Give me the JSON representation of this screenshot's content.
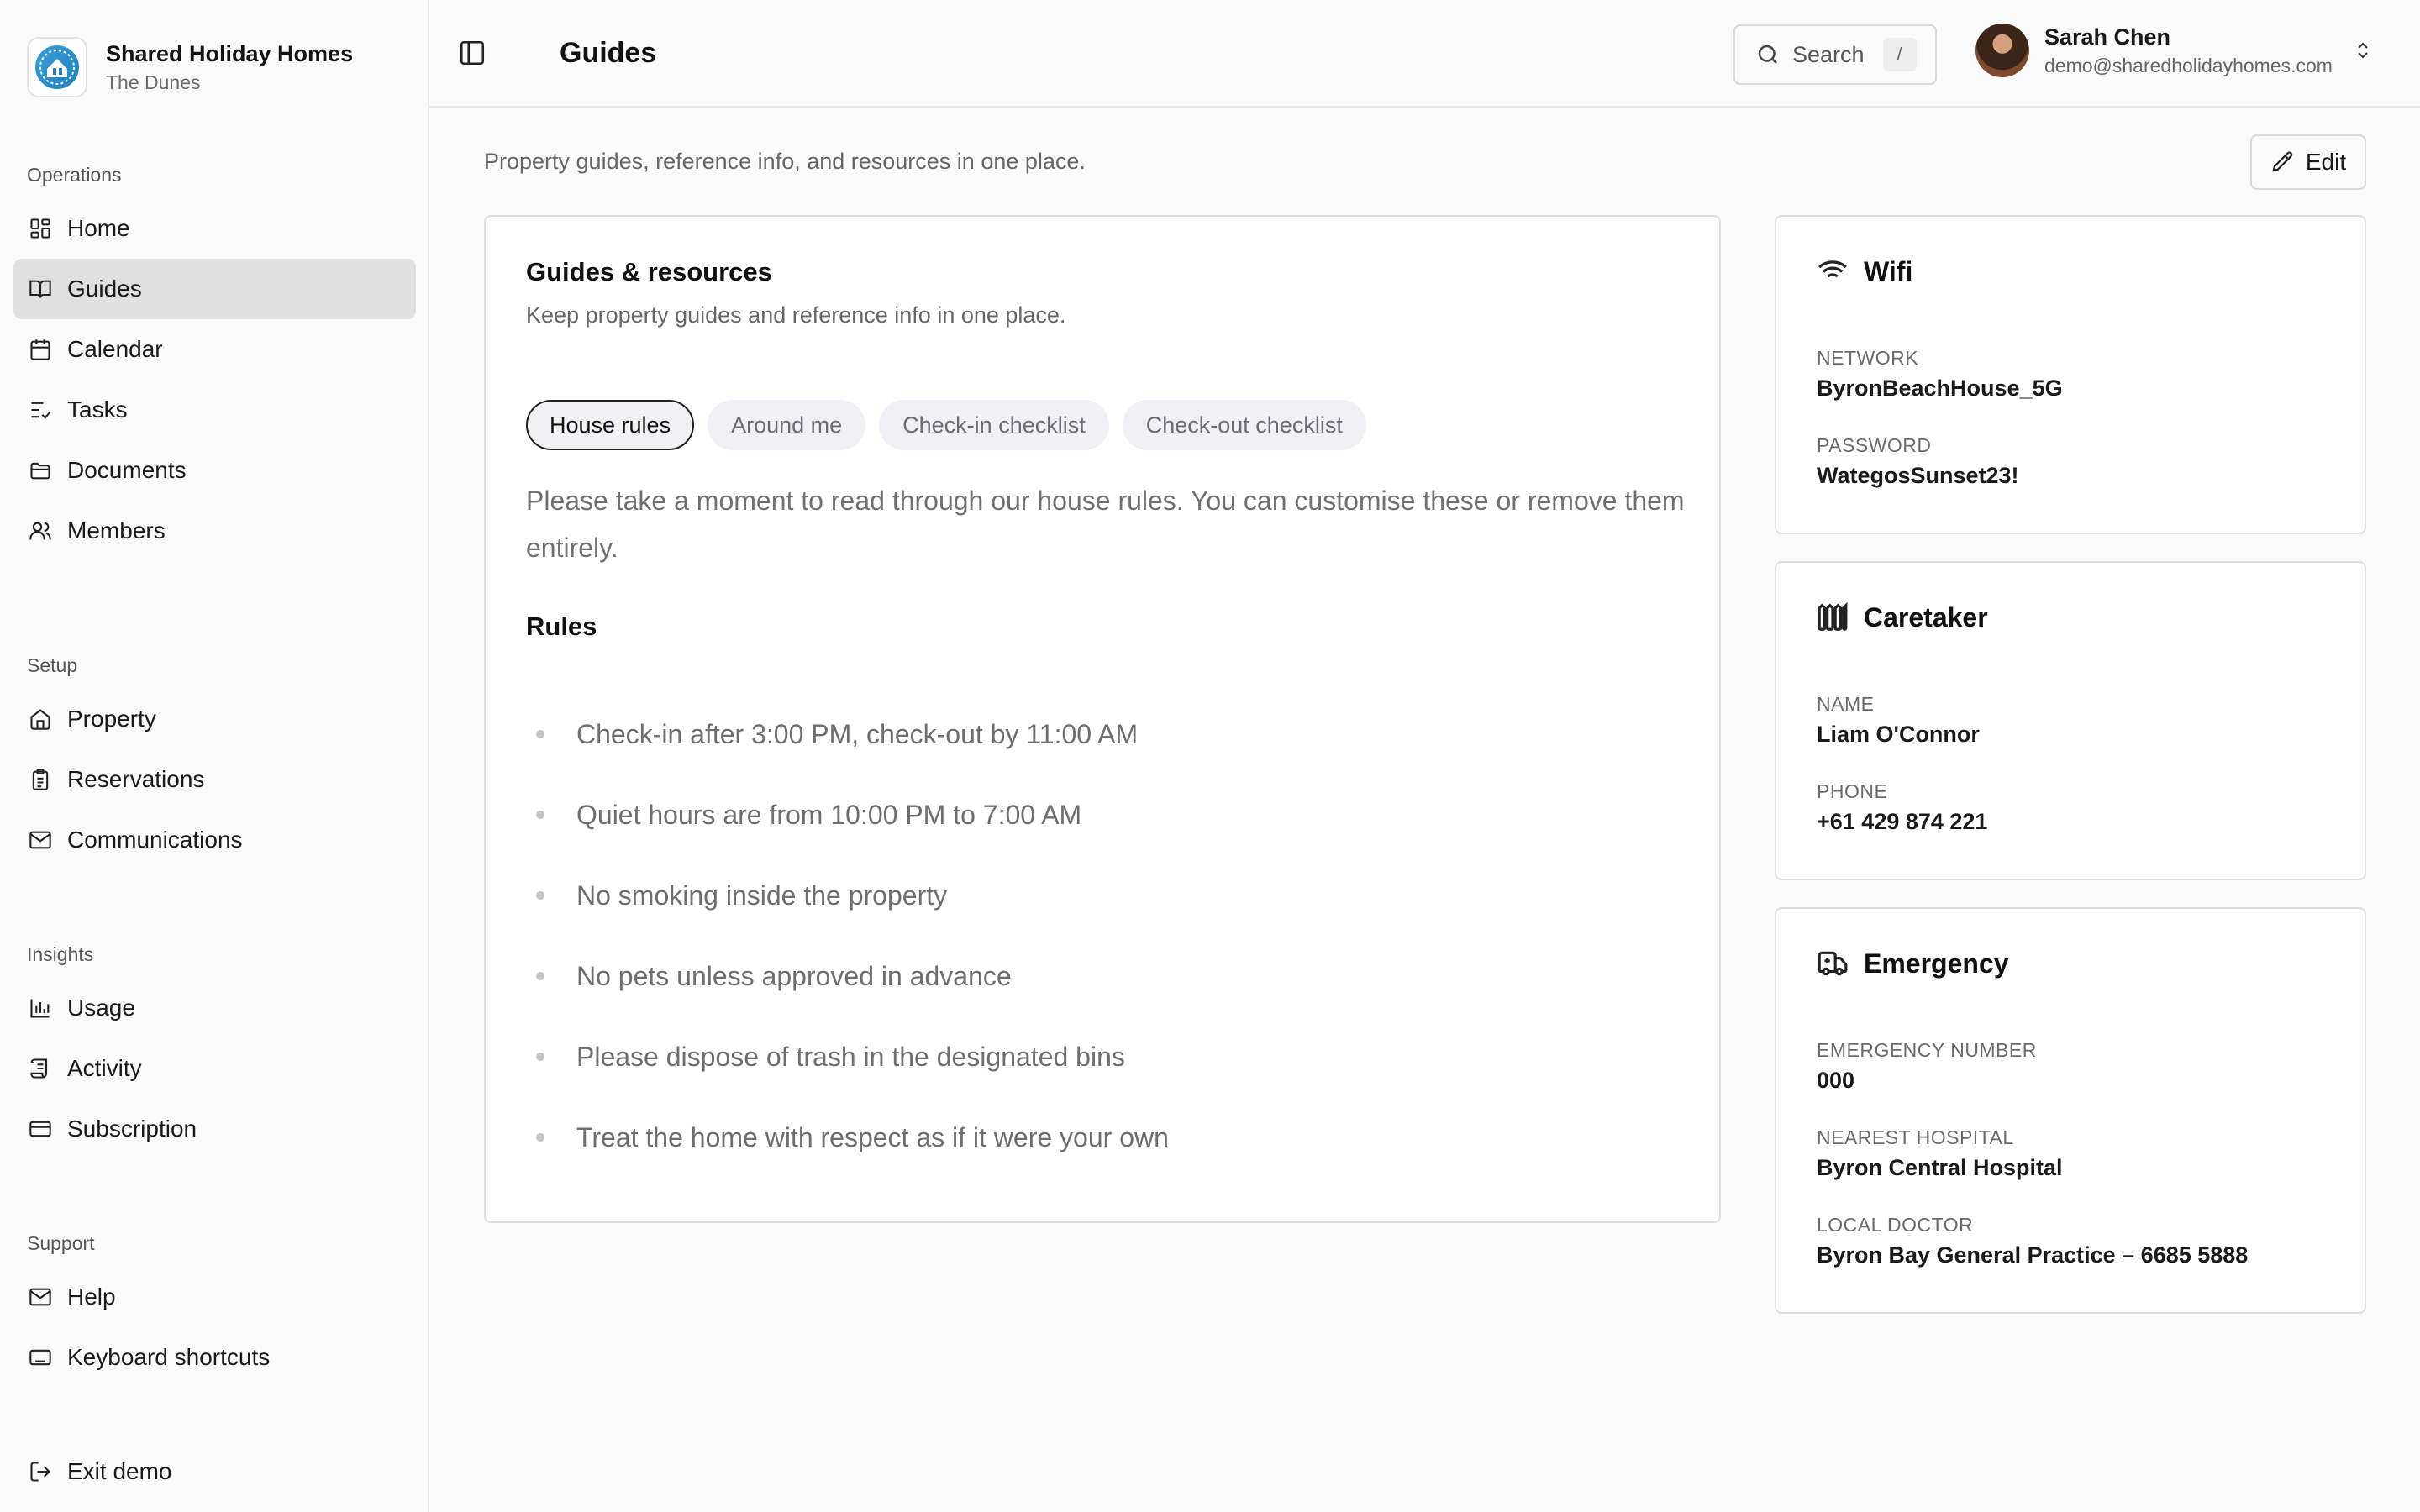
{
  "brand": {
    "name": "Shared Holiday Homes",
    "property": "The Dunes"
  },
  "sidebar": {
    "sections": [
      {
        "heading": "Operations",
        "items": [
          {
            "label": "Home",
            "icon": "dashboard-icon"
          },
          {
            "label": "Guides",
            "icon": "book-icon",
            "active": true
          },
          {
            "label": "Calendar",
            "icon": "calendar-icon"
          },
          {
            "label": "Tasks",
            "icon": "tasks-icon"
          },
          {
            "label": "Documents",
            "icon": "folder-icon"
          },
          {
            "label": "Members",
            "icon": "users-icon"
          }
        ]
      },
      {
        "heading": "Setup",
        "items": [
          {
            "label": "Property",
            "icon": "house-icon"
          },
          {
            "label": "Reservations",
            "icon": "clipboard-icon"
          },
          {
            "label": "Communications",
            "icon": "mail-icon"
          }
        ]
      },
      {
        "heading": "Insights",
        "items": [
          {
            "label": "Usage",
            "icon": "bar-chart-icon"
          },
          {
            "label": "Activity",
            "icon": "scroll-icon"
          },
          {
            "label": "Subscription",
            "icon": "credit-card-icon"
          }
        ]
      },
      {
        "heading": "Support",
        "items": [
          {
            "label": "Help",
            "icon": "mail-icon"
          },
          {
            "label": "Keyboard shortcuts",
            "icon": "keyboard-icon"
          }
        ]
      }
    ],
    "exit_label": "Exit demo"
  },
  "header": {
    "title": "Guides",
    "search_label": "Search",
    "search_shortcut": "/",
    "user": {
      "name": "Sarah Chen",
      "email": "demo@sharedholidayhomes.com"
    }
  },
  "page": {
    "subtitle": "Property guides, reference info, and resources in one place.",
    "edit_label": "Edit"
  },
  "guides": {
    "title": "Guides & resources",
    "description": "Keep property guides and reference info in one place.",
    "tabs": [
      "House rules",
      "Around me",
      "Check-in checklist",
      "Check-out checklist"
    ],
    "active_tab": "House rules",
    "intro": "Please take a moment to read through our house rules. You can customise these or remove them entirely.",
    "rules_title": "Rules",
    "rules": [
      "Check-in after 3:00 PM, check-out by 11:00 AM",
      "Quiet hours are from 10:00 PM to 7:00 AM",
      "No smoking inside the property",
      "No pets unless approved in advance",
      "Please dispose of trash in the designated bins",
      "Treat the home with respect as if it were your own"
    ]
  },
  "wifi": {
    "title": "Wifi",
    "network_label": "NETWORK",
    "network": "ByronBeachHouse_5G",
    "password_label": "PASSWORD",
    "password": "WategosSunset23!"
  },
  "caretaker": {
    "title": "Caretaker",
    "name_label": "NAME",
    "name": "Liam O'Connor",
    "phone_label": "PHONE",
    "phone": "+61 429 874 221"
  },
  "emergency": {
    "title": "Emergency",
    "number_label": "EMERGENCY NUMBER",
    "number": "000",
    "hospital_label": "NEAREST HOSPITAL",
    "hospital": "Byron Central Hospital",
    "doctor_label": "LOCAL DOCTOR",
    "doctor": "Byron Bay General Practice – 6685 5888"
  }
}
